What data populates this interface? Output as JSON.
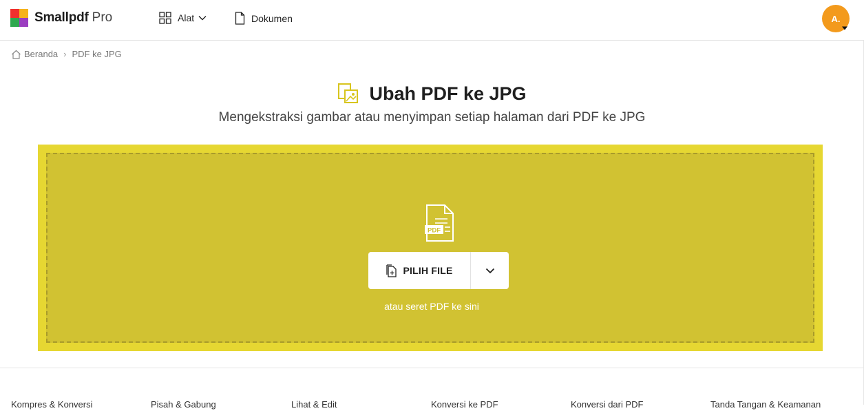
{
  "brand": {
    "name": "Smallpdf",
    "tier": "Pro",
    "logo_colors": [
      "#f0302e",
      "#f6b31b",
      "#2fa84f",
      "#9b3ec0"
    ]
  },
  "nav": {
    "tools_label": "Alat",
    "documents_label": "Dokumen"
  },
  "user": {
    "initials": "A.",
    "avatar_color": "#f39a1c"
  },
  "breadcrumb": {
    "home": "Beranda",
    "separator": "›",
    "current": "PDF ke JPG"
  },
  "page": {
    "title": "Ubah PDF ke JPG",
    "subtitle": "Mengekstraksi gambar atau menyimpan setiap halaman dari PDF ke JPG",
    "accent_color": "#e6d732"
  },
  "upload": {
    "file_badge": "PDF",
    "choose_label": "PILIH FILE",
    "drop_hint": "atau seret PDF ke sini"
  },
  "footer": {
    "links": [
      "Kompres & Konversi",
      "Pisah & Gabung",
      "Lihat & Edit",
      "Konversi ke PDF",
      "Konversi dari PDF",
      "Tanda Tangan & Keamanan"
    ]
  }
}
